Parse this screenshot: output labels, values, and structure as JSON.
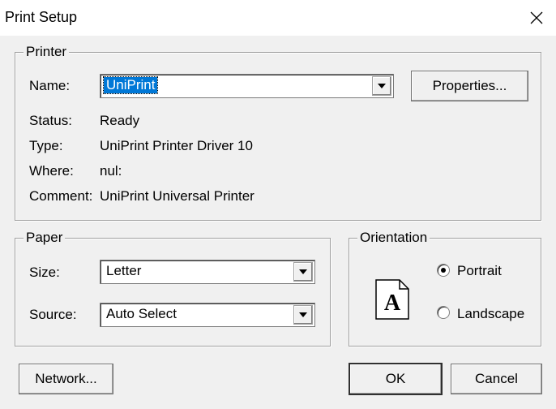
{
  "window": {
    "title": "Print Setup"
  },
  "printer": {
    "group_label": "Printer",
    "name_label": "Name:",
    "name_value": "UniPrint",
    "properties_label": "Properties...",
    "status_label": "Status:",
    "status_value": "Ready",
    "type_label": "Type:",
    "type_value": "UniPrint Printer Driver 10",
    "where_label": "Where:",
    "where_value": "nul:",
    "comment_label": "Comment:",
    "comment_value": "UniPrint Universal Printer"
  },
  "paper": {
    "group_label": "Paper",
    "size_label": "Size:",
    "size_value": "Letter",
    "source_label": "Source:",
    "source_value": "Auto Select"
  },
  "orientation": {
    "group_label": "Orientation",
    "portrait_label": "Portrait",
    "landscape_label": "Landscape",
    "selected": "Portrait",
    "page_icon_letter": "A"
  },
  "buttons": {
    "network_label": "Network...",
    "ok_label": "OK",
    "cancel_label": "Cancel"
  },
  "icons": {
    "close": "close-icon",
    "dropdown": "chevron-down-icon",
    "page": "portrait-page-icon"
  }
}
